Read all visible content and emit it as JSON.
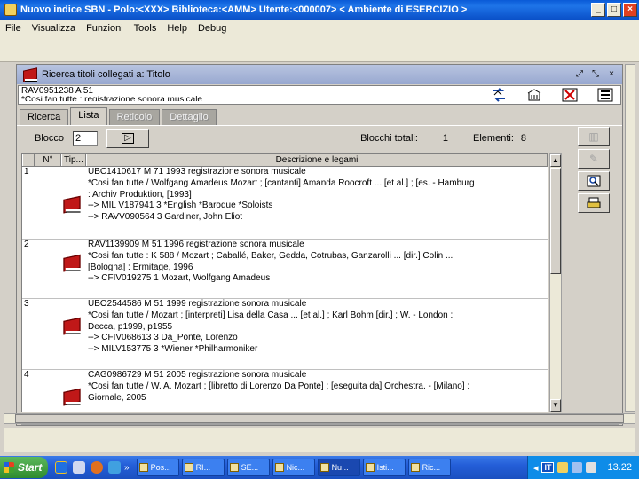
{
  "window": {
    "title": "Nuovo indice SBN - Polo:<XXX> Biblioteca:<AMM> Utente:<000007>        < Ambiente di ESERCIZIO >",
    "min": "_",
    "max": "□",
    "close": "×"
  },
  "menu": [
    "File",
    "Visualizza",
    "Funzioni",
    "Tools",
    "Help",
    "Debug"
  ],
  "frame": {
    "title": "Ricerca titoli collegati a: Titolo",
    "title_buttons": [
      "⤢",
      "⤡",
      "×"
    ],
    "record_lines": [
      "RAV0951238  A 51",
      "*Cosi fan tutte ; registrazione sonora musicale"
    ],
    "tabs": [
      {
        "label": "Ricerca",
        "state": "normal"
      },
      {
        "label": "Lista",
        "state": "active"
      },
      {
        "label": "Reticolo",
        "state": "disabled"
      },
      {
        "label": "Dettaglio",
        "state": "disabled"
      }
    ],
    "blocco_label": "Blocco",
    "blocco_value": "2",
    "blocchi_totali_label": "Blocchi totali:",
    "blocchi_totali_value": "1",
    "elementi_label": "Elementi:",
    "elementi_value": "8"
  },
  "table": {
    "headers": [
      "N°",
      "Tip...",
      "Descrizione e legami"
    ],
    "rows": [
      {
        "n": "1",
        "lines": [
          "UBC1410617 M 71 1993 registrazione sonora musicale",
          "*Cosi fan tutte / Wolfgang Amadeus Mozart ; [cantanti] Amanda Roocroft ... [et al.] ; [es. - Hamburg",
          ": Archiv Produktion, [1993]",
          "--> MIL V187941 3 *English *Baroque *Soloists",
          "--> RAVV090564 3 Gardiner, John Eliot"
        ]
      },
      {
        "n": "2",
        "lines": [
          "RAV1139909 M 51 1996 registrazione sonora musicale",
          "*Cosi fan tutte : K 588 / Mozart ; Caballé, Baker, Gedda, Cotrubas, Ganzarolli ... [dir.] Colin ...",
          "[Bologna] : Ermitage, 1996",
          "--> CFIV019275 1 Mozart, Wolfgang Amadeus"
        ]
      },
      {
        "n": "3",
        "lines": [
          "UBO2544586 M 51 1999 registrazione sonora musicale",
          "*Cosi fan tutte / Mozart ; [interpreti] Lisa della Casa ... [et al.] ; Karl Bohm [dir.] ; W. - London :",
          "Decca, p1999, p1955",
          "--> CFIV068613 3 Da_Ponte, Lorenzo",
          "--> MILV153775 3 *Wiener *Philharmoniker"
        ]
      },
      {
        "n": "4",
        "lines": [
          "CAG0986729 M 51 2005 registrazione sonora musicale",
          "*Cosi fan tutte / W. A. Mozart ; [libretto di Lorenzo Da Ponte] ; [eseguita da] Orchestra. - [Milano] :",
          "Giornale, 2005"
        ]
      }
    ]
  },
  "record_buttons": [
    "swap-icon",
    "building-icon",
    "delete-icon",
    "list-icon"
  ],
  "side_buttons": [
    "books-icon",
    "edit-icon",
    "search-icon",
    "print-icon"
  ],
  "taskbar": {
    "start": "Start",
    "chevron": "»",
    "tasks": [
      "Pos...",
      "RI...",
      "SE...",
      "Nic...",
      "Nu...",
      "Isti...",
      "Ric..."
    ],
    "lang": "IT",
    "clock": "13.22"
  }
}
